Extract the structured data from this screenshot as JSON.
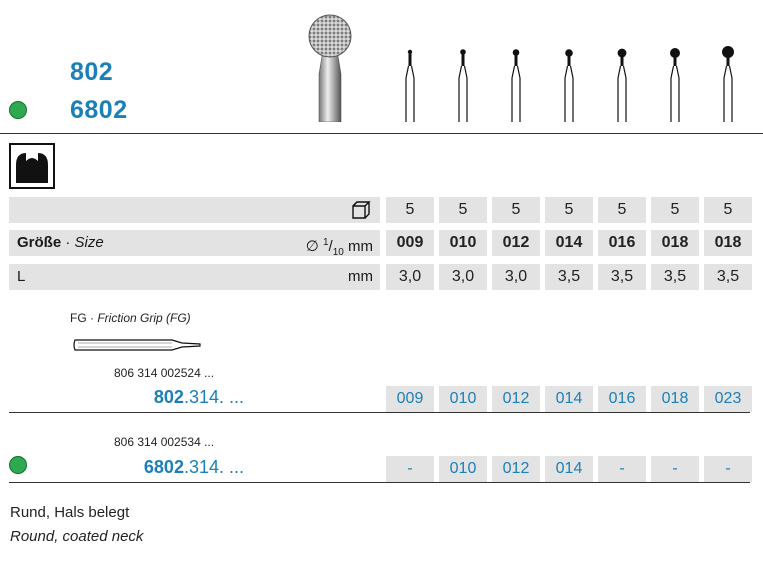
{
  "header": {
    "code_primary": "802",
    "code_secondary": "6802",
    "secondary_marker_color": "#2fa84f"
  },
  "accent_color": "#1b7fb8",
  "icons": {
    "shape_symbol": "round-bur-cross-section-icon",
    "package_symbol": "package-box-icon"
  },
  "table": {
    "package_row": {
      "values": [
        "5",
        "5",
        "5",
        "5",
        "5",
        "5",
        "5"
      ]
    },
    "size_row": {
      "label_de": "Größe",
      "separator": " · ",
      "label_en": "Size",
      "unit_prefix": "∅",
      "unit_num": "1",
      "unit_den": "10",
      "unit_suffix": "mm",
      "values": [
        "009",
        "010",
        "012",
        "014",
        "016",
        "018",
        "018"
      ]
    },
    "length_row": {
      "label": "L",
      "unit": "mm",
      "values": [
        "3,0",
        "3,0",
        "3,0",
        "3,5",
        "3,5",
        "3,5",
        "3,5"
      ]
    }
  },
  "shank": {
    "label_abbr": "FG",
    "separator": " · ",
    "label_full": "Friction Grip (FG)"
  },
  "products": [
    {
      "ref": "806 314 002524 ...",
      "code_bold": "802",
      "code_rest": ".314. ...",
      "sizes": [
        "009",
        "010",
        "012",
        "014",
        "016",
        "018",
        "023"
      ]
    },
    {
      "ref": "806 314 002534 ...",
      "code_bold": "6802",
      "code_rest": ".314. ...",
      "sizes": [
        "-",
        "010",
        "012",
        "014",
        "-",
        "-",
        "-"
      ]
    }
  ],
  "footer": {
    "description_de": "Rund, Hals belegt",
    "description_en": "Round, coated neck"
  }
}
